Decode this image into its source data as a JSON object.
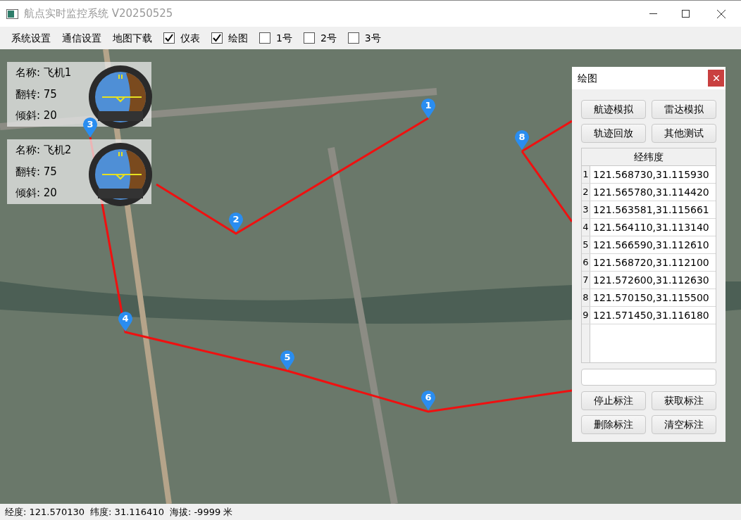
{
  "window": {
    "title": "航点实时监控系统 V20250525"
  },
  "toolbar": [
    {
      "kind": "menu",
      "label": "系统设置"
    },
    {
      "kind": "menu",
      "label": "通信设置"
    },
    {
      "kind": "menu",
      "label": "地图下载"
    },
    {
      "kind": "checkbox",
      "label": "仪表",
      "checked": true
    },
    {
      "kind": "checkbox",
      "label": "绘图",
      "checked": true
    },
    {
      "kind": "checkbox",
      "label": "1号",
      "checked": false
    },
    {
      "kind": "checkbox",
      "label": "2号",
      "checked": false
    },
    {
      "kind": "checkbox",
      "label": "3号",
      "checked": false
    }
  ],
  "aircraft": [
    {
      "lines": [
        "名称: 飞机1",
        "翻转: 75",
        "倾斜: 20"
      ]
    },
    {
      "lines": [
        "名称: 飞机2",
        "翻转: 75",
        "倾斜: 20"
      ]
    }
  ],
  "markers": [
    {
      "label": "1"
    },
    {
      "label": "2"
    },
    {
      "label": "3"
    },
    {
      "label": "4"
    },
    {
      "label": "5"
    },
    {
      "label": "6"
    },
    {
      "label": "8"
    }
  ],
  "panel": {
    "title": "绘图",
    "top_buttons": [
      "航迹模拟",
      "雷达模拟",
      "轨迹回放",
      "其他测试"
    ],
    "table": {
      "header": "经纬度",
      "rows": [
        {
          "index": "1",
          "value": "121.568730,31.115930"
        },
        {
          "index": "2",
          "value": "121.565780,31.114420"
        },
        {
          "index": "3",
          "value": "121.563581,31.115661"
        },
        {
          "index": "4",
          "value": "121.564110,31.113140"
        },
        {
          "index": "5",
          "value": "121.566590,31.112610"
        },
        {
          "index": "6",
          "value": "121.568720,31.112100"
        },
        {
          "index": "7",
          "value": "121.572600,31.112630"
        },
        {
          "index": "8",
          "value": "121.570150,31.115500"
        },
        {
          "index": "9",
          "value": "121.571450,31.116180"
        }
      ]
    },
    "bottom_buttons": [
      "停止标注",
      "获取标注",
      "删除标注",
      "清空标注"
    ]
  },
  "status_bar": [
    "经度: 121.570130",
    "纬度: 31.116410",
    "海拔: -9999 米"
  ]
}
